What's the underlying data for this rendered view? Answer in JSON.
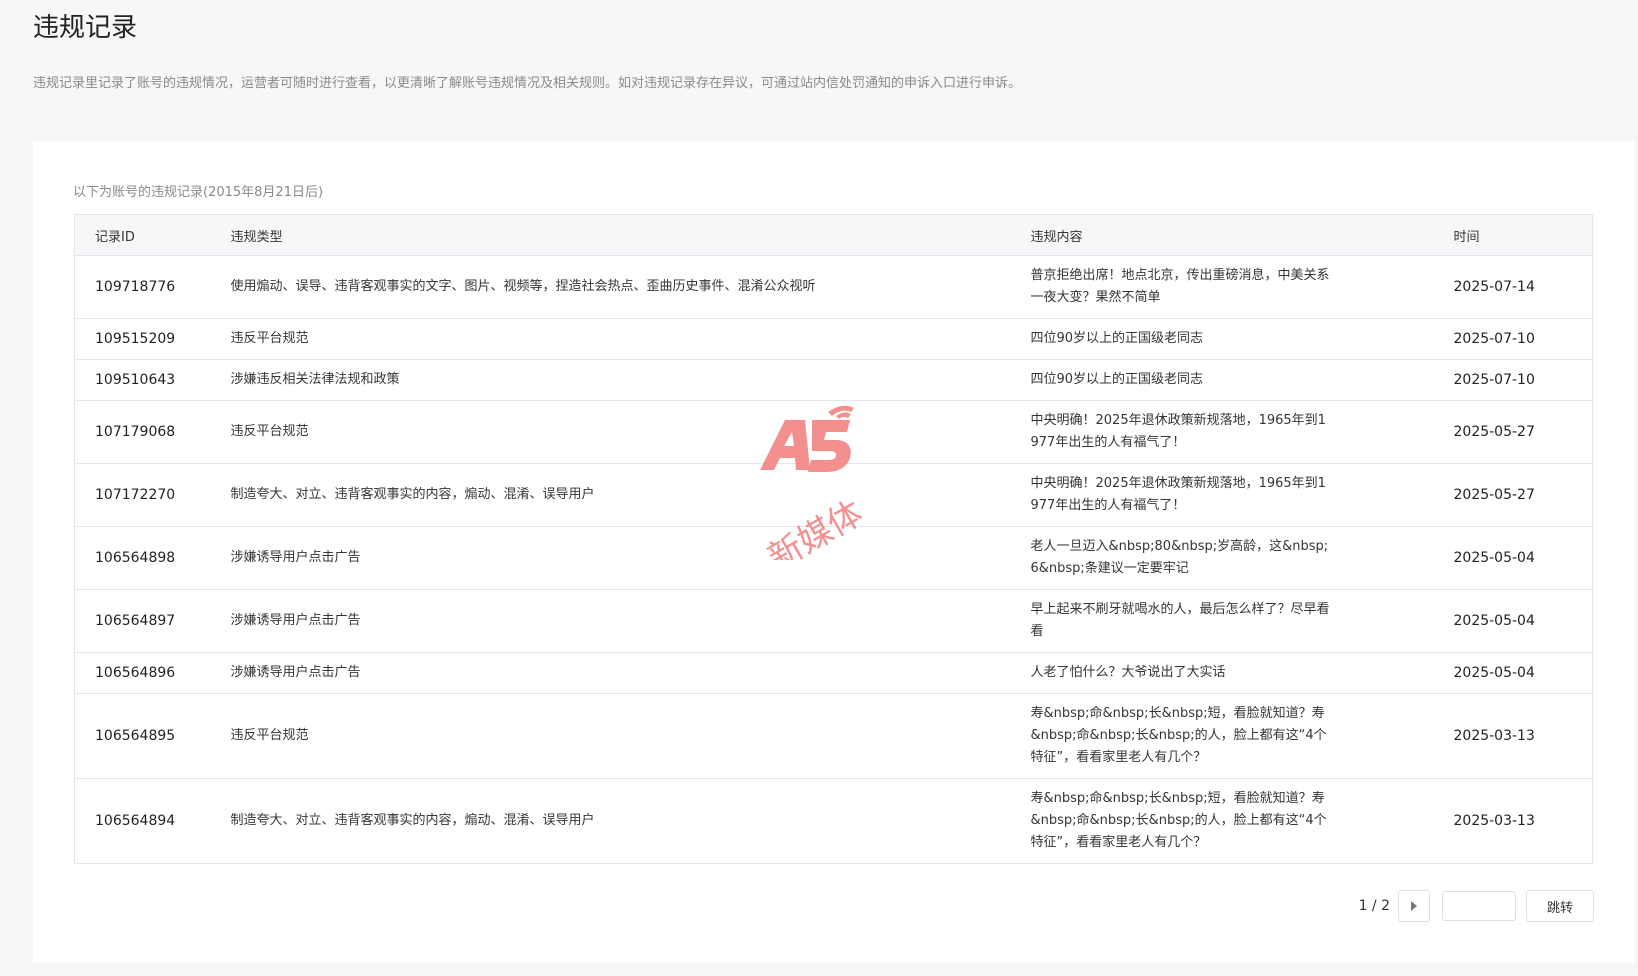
{
  "page": {
    "title": "违规记录",
    "description": "违规记录里记录了账号的违规情况，运营者可随时进行查看，以更清晰了解账号违规情况及相关规则。如对违规记录存在异议，可通过站内信处罚通知的申诉入口进行申诉。"
  },
  "table": {
    "caption": "以下为账号的违规记录(2015年8月21日后)",
    "columns": [
      "记录ID",
      "违规类型",
      "违规内容",
      "时间"
    ],
    "rows": [
      {
        "id": "109718776",
        "type": "使用煽动、误导、违背客观事实的文字、图片、视频等，捏造社会热点、歪曲历史事件、混淆公众视听",
        "content": "普京拒绝出席！地点北京，传出重磅消息，中美关系一夜大变？果然不简单",
        "time": "2025-07-14"
      },
      {
        "id": "109515209",
        "type": "违反平台规范",
        "content": "四位90岁以上的正国级老同志",
        "time": "2025-07-10"
      },
      {
        "id": "109510643",
        "type": "涉嫌违反相关法律法规和政策",
        "content": "四位90岁以上的正国级老同志",
        "time": "2025-07-10"
      },
      {
        "id": "107179068",
        "type": "违反平台规范",
        "content": "中央明确！2025年退休政策新规落地，1965年到1977年出生的人有福气了！",
        "time": "2025-05-27"
      },
      {
        "id": "107172270",
        "type": "制造夸大、对立、违背客观事实的内容，煽动、混淆、误导用户",
        "content": "中央明确！2025年退休政策新规落地，1965年到1977年出生的人有福气了！",
        "time": "2025-05-27"
      },
      {
        "id": "106564898",
        "type": "涉嫌诱导用户点击广告",
        "content": "老人一旦迈入&nbsp;80&nbsp;岁高龄，这&nbsp;6&nbsp;条建议一定要牢记",
        "time": "2025-05-04"
      },
      {
        "id": "106564897",
        "type": "涉嫌诱导用户点击广告",
        "content": "早上起来不刷牙就喝水的人，最后怎么样了？尽早看看",
        "time": "2025-05-04"
      },
      {
        "id": "106564896",
        "type": "涉嫌诱导用户点击广告",
        "content": "人老了怕什么？大爷说出了大实话",
        "time": "2025-05-04"
      },
      {
        "id": "106564895",
        "type": "违反平台规范",
        "content": "寿&nbsp;命&nbsp;长&nbsp;短，看脸就知道？寿&nbsp;命&nbsp;长&nbsp;的人，脸上都有这“4个特征”，看看家里老人有几个？",
        "time": "2025-03-13"
      },
      {
        "id": "106564894",
        "type": "制造夸大、对立、违背客观事实的内容，煽动、混淆、误导用户",
        "content": "寿&nbsp;命&nbsp;长&nbsp;短，看脸就知道？寿&nbsp;命&nbsp;长&nbsp;的人，脸上都有这“4个特征”，看看家里老人有几个？",
        "time": "2025-03-13"
      }
    ]
  },
  "pagination": {
    "count": "1 / 2",
    "next_icon": "caret-right-icon",
    "jump_placeholder": "",
    "jump_label": "跳转"
  },
  "watermark": {
    "logo": "A5",
    "text": "新媒体",
    "color": "#f07d7d"
  }
}
